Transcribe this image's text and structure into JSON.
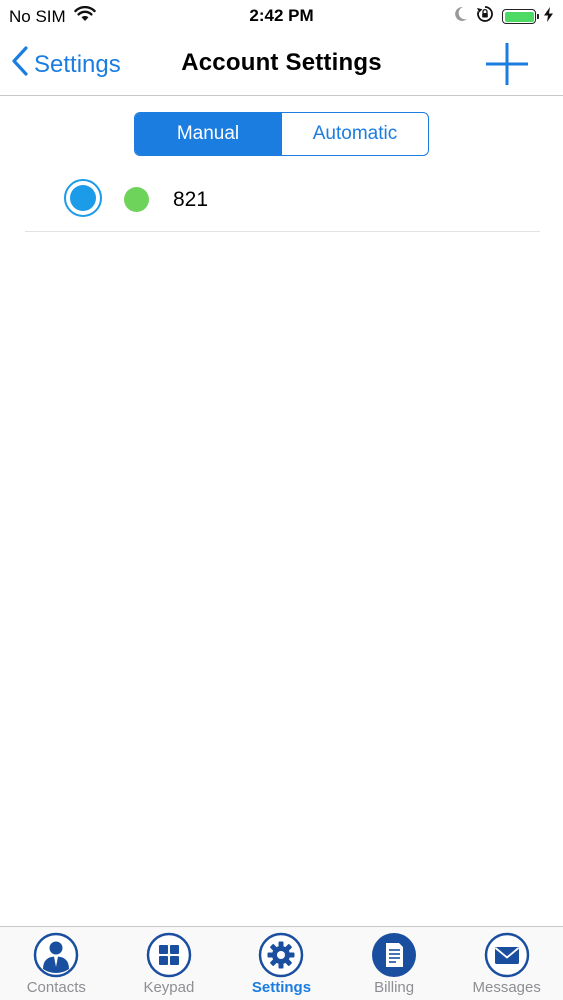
{
  "status_bar": {
    "carrier": "No SIM",
    "time": "2:42 PM",
    "battery_level": 1.0,
    "icons": [
      "wifi-icon",
      "moon-icon",
      "rotation-lock-icon",
      "battery-icon",
      "charging-icon"
    ]
  },
  "nav": {
    "back_label": "Settings",
    "title": "Account Settings",
    "add_icon": "plus-icon"
  },
  "segmented": {
    "options": [
      "Manual",
      "Automatic"
    ],
    "selected": "Manual"
  },
  "accounts": [
    {
      "name": "821",
      "selected": true,
      "status": "online"
    }
  ],
  "tabs": [
    {
      "label": "Contacts",
      "icon": "contact-person-icon",
      "active": false
    },
    {
      "label": "Keypad",
      "icon": "keypad-grid-icon",
      "active": false
    },
    {
      "label": "Settings",
      "icon": "gear-icon",
      "active": true
    },
    {
      "label": "Billing",
      "icon": "billing-document-icon",
      "active": false
    },
    {
      "label": "Messages",
      "icon": "envelope-icon",
      "active": false
    }
  ],
  "colors": {
    "accent": "#1b7de0",
    "tab_icon_blue": "#1a4fa0",
    "radio_blue": "#1b9be8",
    "online_green": "#6ed35a",
    "battery_green": "#4cd964"
  }
}
